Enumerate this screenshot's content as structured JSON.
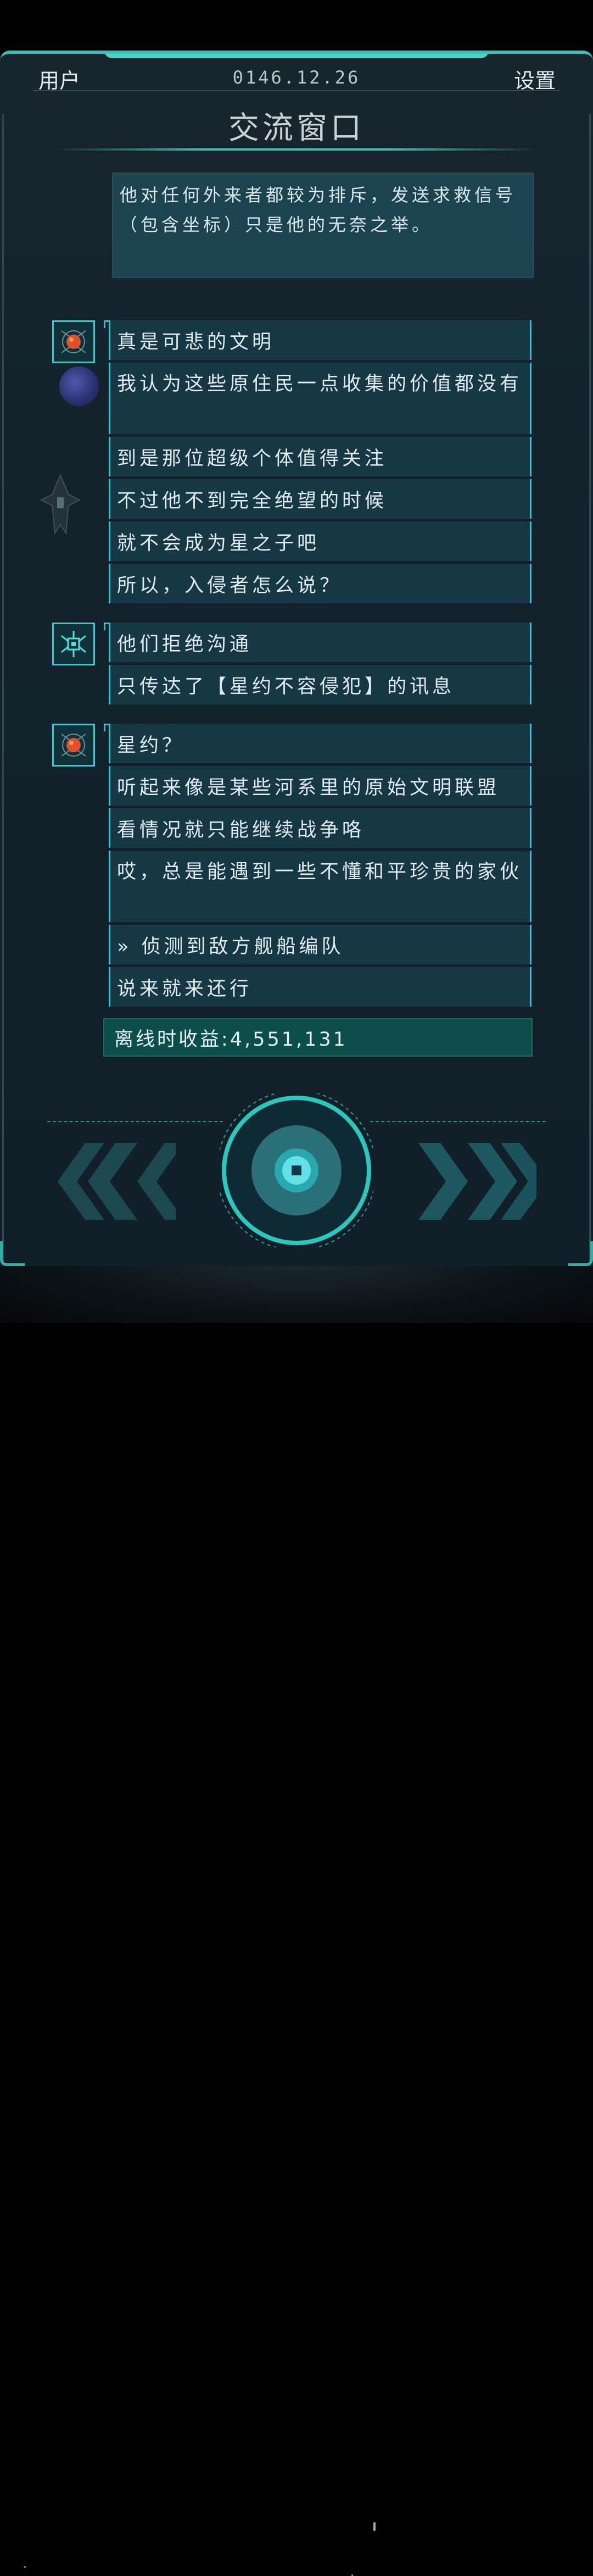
{
  "header": {
    "user_label": "用户",
    "date": "0146.12.26",
    "settings_label": "设置",
    "title": "交流窗口"
  },
  "previous_message": {
    "lines": [
      "他对任何外来者都较为排斥，发送求救信号",
      "（包含坐标）只是他的无奈之举。"
    ]
  },
  "groups": [
    {
      "avatar": "orange-core-avatar-icon",
      "messages": [
        "真是可悲的文明",
        "我认为这些原住民一点收集的价值都没有",
        "到是那位超级个体值得关注",
        "不过他不到完全绝望的时候",
        "就不会成为星之子吧",
        "所以，入侵者怎么说？"
      ]
    },
    {
      "avatar": "cyan-chip-avatar-icon",
      "messages": [
        "他们拒绝沟通",
        "只传达了【星约不容侵犯】的讯息"
      ]
    },
    {
      "avatar": "orange-core-avatar-icon",
      "messages": [
        "星约？",
        "听起来像是某些河系里的原始文明联盟",
        "看情况就只能继续战争咯",
        "哎，总是能遇到一些不懂和平珍贵的家伙",
        "» 侦测到敌方舰船编队",
        "说来就来还行"
      ]
    }
  ],
  "income_bar": {
    "text": "离线时收益:4,551,131"
  },
  "controls": {
    "prev_icon": "double-chevron-left-icon",
    "center_icon": "center-round-button-icon",
    "next_icon": "double-chevron-right-icon"
  },
  "colors": {
    "accent": "#3bbfb6",
    "bubble_bg": "#163744",
    "income_bg": "#0b4e4a"
  }
}
